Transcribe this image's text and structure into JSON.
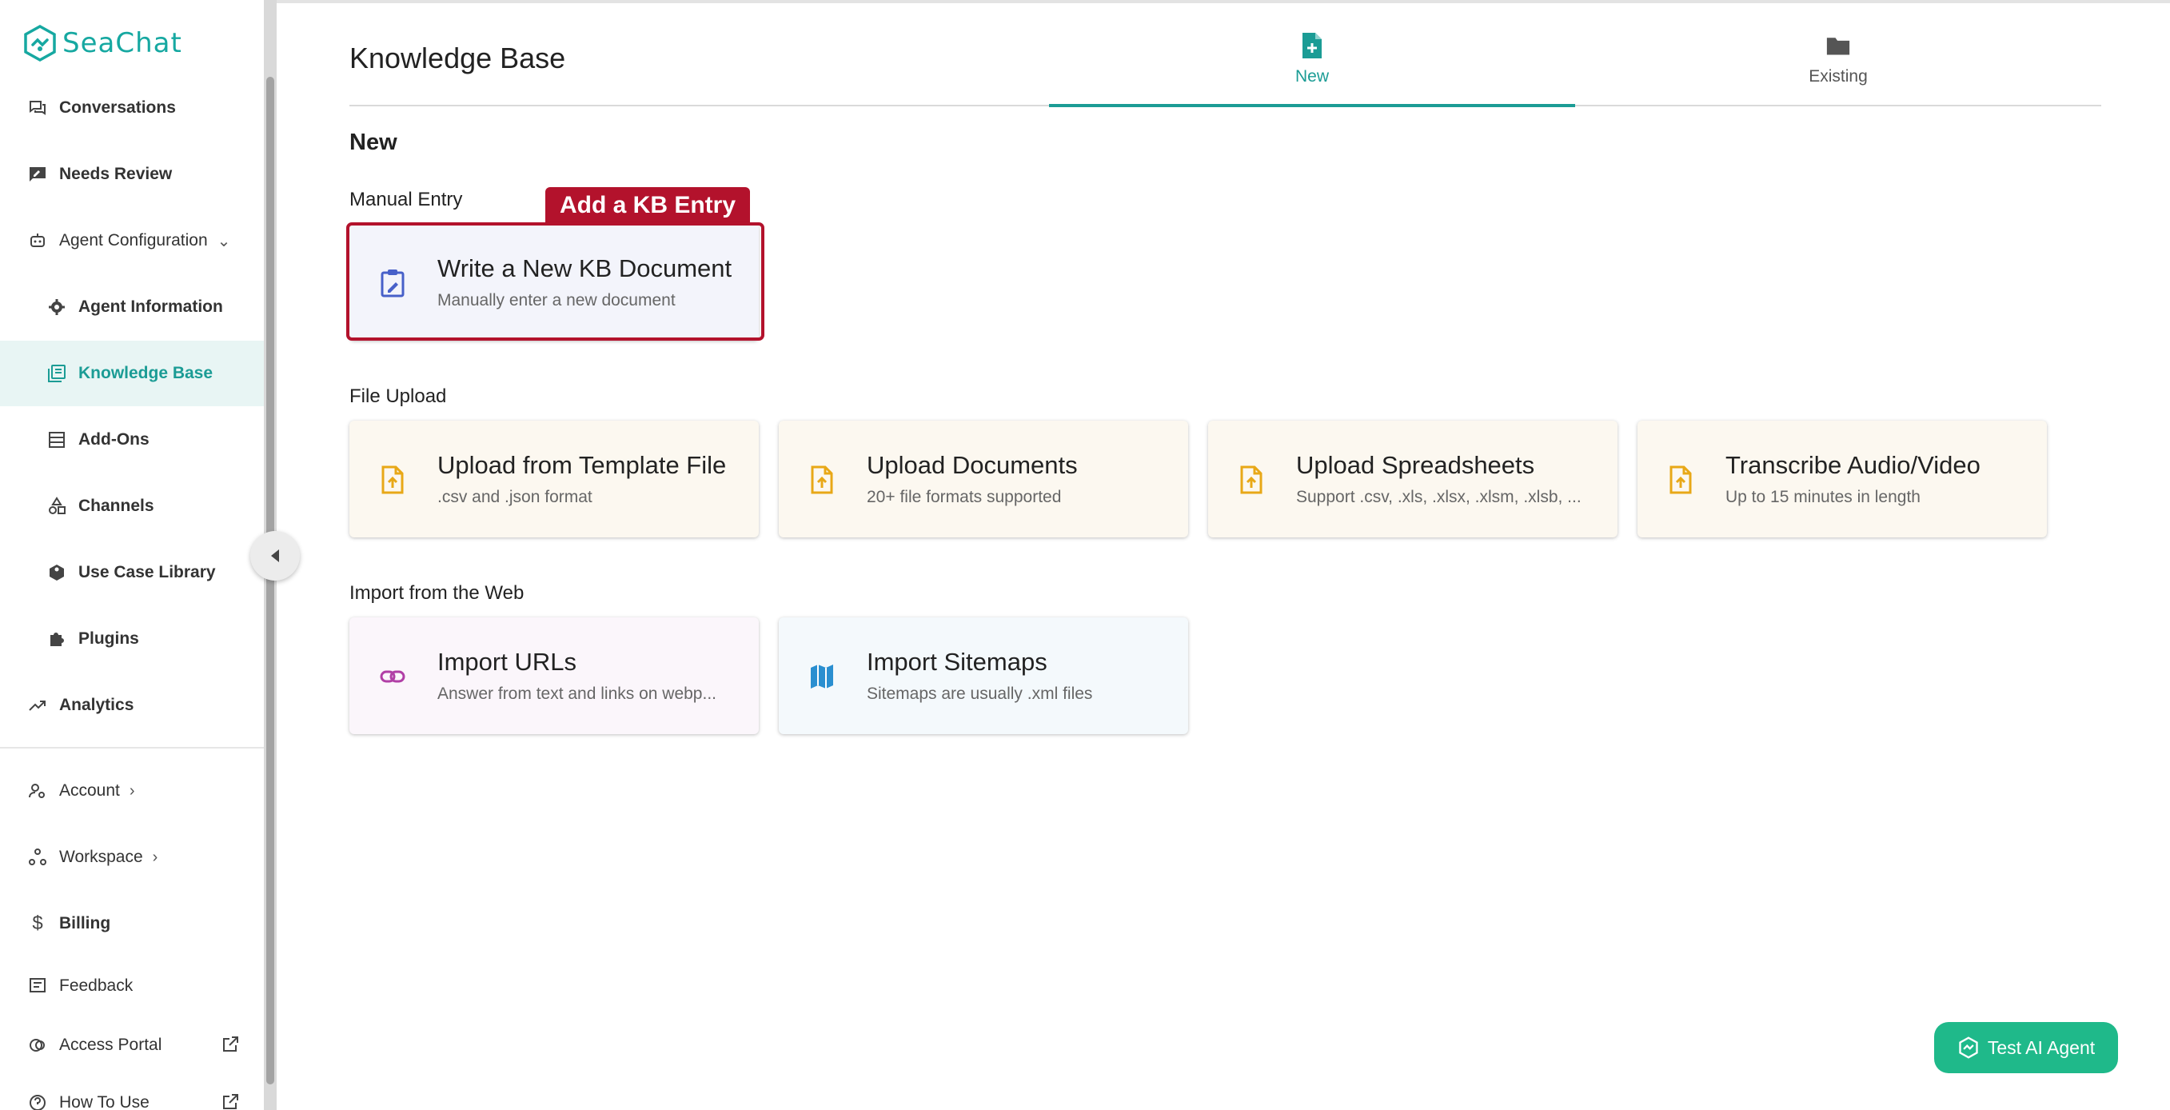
{
  "app": {
    "logo_text": "SeaChat"
  },
  "sidebar": {
    "items": [
      {
        "label": "Conversations",
        "icon": "forum-icon"
      },
      {
        "label": "Needs Review",
        "icon": "rate-review-icon"
      },
      {
        "label": "Agent Configuration",
        "icon": "robot-icon",
        "expanded": true
      },
      {
        "label": "Agent Information",
        "icon": "gear-icon"
      },
      {
        "label": "Knowledge Base",
        "icon": "library-books-icon",
        "active": true
      },
      {
        "label": "Add-Ons",
        "icon": "table-icon"
      },
      {
        "label": "Channels",
        "icon": "category-icon"
      },
      {
        "label": "Use Case Library",
        "icon": "box-icon"
      },
      {
        "label": "Plugins",
        "icon": "puzzle-icon"
      },
      {
        "label": "Analytics",
        "icon": "trending-up-icon"
      },
      {
        "label": "Account",
        "icon": "account-icon"
      },
      {
        "label": "Workspace",
        "icon": "workspace-icon"
      },
      {
        "label": "Billing",
        "icon": "dollar-icon"
      },
      {
        "label": "Feedback",
        "icon": "feedback-icon"
      },
      {
        "label": "Access Portal",
        "icon": "portal-icon"
      },
      {
        "label": "How To Use",
        "icon": "help-icon"
      }
    ]
  },
  "header": {
    "title": "Knowledge Base",
    "tabs": [
      {
        "label": "New",
        "icon": "note-add-icon",
        "active": true
      },
      {
        "label": "Existing",
        "icon": "folder-icon",
        "active": false
      }
    ]
  },
  "main": {
    "section_title": "New",
    "manual": {
      "label": "Manual Entry",
      "tag": "Add a KB Entry",
      "cards": [
        {
          "title": "Write a New KB Document",
          "subtitle": "Manually enter a new document",
          "icon": "edit-clipboard-icon"
        }
      ]
    },
    "file_upload": {
      "label": "File Upload",
      "cards": [
        {
          "title": "Upload from Template File",
          "subtitle": ".csv and .json format",
          "icon": "file-upload-icon"
        },
        {
          "title": "Upload Documents",
          "subtitle": "20+ file formats supported",
          "icon": "file-upload-icon"
        },
        {
          "title": "Upload Spreadsheets",
          "subtitle": "Support .csv, .xls, .xlsx, .xlsm, .xlsb, ...",
          "icon": "file-upload-icon"
        },
        {
          "title": "Transcribe Audio/Video",
          "subtitle": "Up to 15 minutes in length",
          "icon": "file-upload-icon"
        }
      ]
    },
    "web": {
      "label": "Import from the Web",
      "cards": [
        {
          "title": "Import URLs",
          "subtitle": "Answer from text and links on webp...",
          "icon": "link-icon"
        },
        {
          "title": "Import Sitemaps",
          "subtitle": "Sitemaps are usually .xml files",
          "icon": "map-icon"
        }
      ]
    }
  },
  "test_button": {
    "label": "Test AI Agent"
  },
  "colors": {
    "accent": "#1b9c95",
    "highlight": "#b3122c",
    "file_icon": "#e8a817",
    "url_icon": "#b13fa6",
    "map_icon": "#2a8fd0",
    "manual_icon": "#4760c9",
    "test_button": "#1fb98a"
  }
}
